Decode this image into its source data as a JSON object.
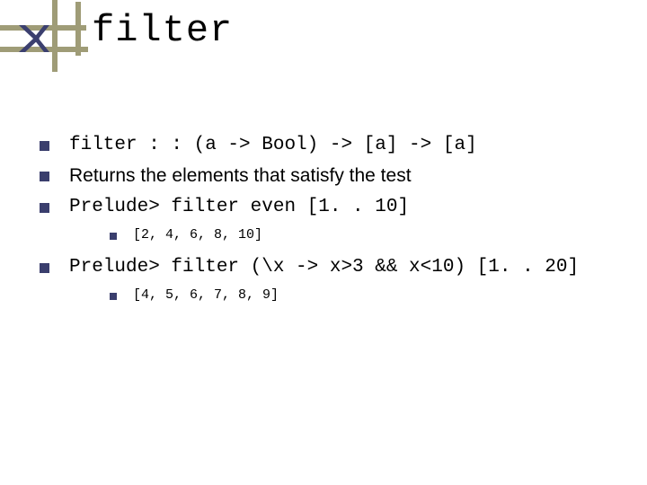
{
  "title": "filter",
  "bullets": {
    "b1": "filter : : (a -> Bool) -> [a] -> [a]",
    "b2": "Returns the elements that satisfy the test",
    "b3": "Prelude> filter even [1. . 10]",
    "b3s": "[2, 4, 6, 8, 10]",
    "b4": "Prelude> filter (\\x -> x>3 && x<10) [1. . 20]",
    "b4s": "[4, 5, 6, 7, 8, 9]"
  }
}
